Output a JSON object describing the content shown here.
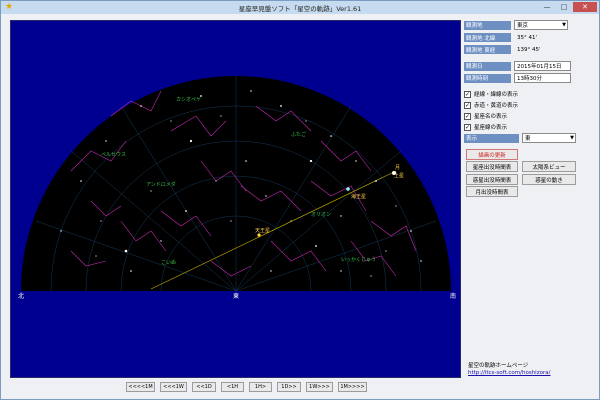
{
  "window": {
    "title": "星座早見盤ソフト「星空の軌跡」Ver1.61"
  },
  "sky": {
    "directions": {
      "north": "北",
      "east": "東",
      "south": "南"
    },
    "labels": {
      "moon": "月",
      "saturn": "土星",
      "mercury": "水星",
      "planet_mark": "火星",
      "uranus_mark": "天王星",
      "neptune_mark": "海王星",
      "const_1": "ペルセウス",
      "const_2": "カシオペヤ",
      "const_3": "アンドロメダ",
      "const_4": "オリオン",
      "const_5": "ふたご",
      "const_6": "いっかくじゅう",
      "const_7": "こいぬ"
    }
  },
  "sidebar": {
    "location_label": "観測地",
    "location_value": "東京",
    "lat_label": "観測地 北緯",
    "lat_value": "35° 41'",
    "lon_label": "観測地 東経",
    "lon_value": "139° 45'",
    "date_label": "観測日",
    "date_value": "2015年01月15日",
    "time_label": "観測時刻",
    "time_value": "13時30分",
    "checks": [
      {
        "label": "経線・緯線の表示",
        "checked": true
      },
      {
        "label": "赤道・黄道の表示",
        "checked": true
      },
      {
        "label": "星座名の表示",
        "checked": true
      },
      {
        "label": "星座線の表示",
        "checked": true
      }
    ],
    "display_label": "表示",
    "display_value": "東",
    "redraw_button": "描画の更新",
    "buttons": {
      "constellation_times": "星座出没時間表",
      "solar_view": "太陽系ビュー",
      "planet_times": "惑星出没時間表",
      "planet_motion": "惑星の動き",
      "moon_times": "月出没時間表"
    },
    "homepage_label": "星空の軌跡ホームページ",
    "homepage_url": "http://itcs-soft.com/hoshizora/"
  },
  "nav": {
    "back_month": "<<<<1M",
    "back_week": "<<<1W",
    "back_day": "<<1D",
    "back_hour": "<1H",
    "fwd_hour": "1H>",
    "fwd_day": "1D>>",
    "fwd_week": "1W>>>",
    "fwd_month": "1M>>>>"
  }
}
